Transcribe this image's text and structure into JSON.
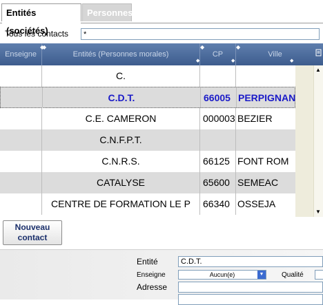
{
  "tabs": [
    {
      "label": "Entités (sociétés)",
      "active": true
    },
    {
      "label": "Personnes",
      "active": false
    }
  ],
  "filter": {
    "label": "Tous les contacts",
    "value": "*"
  },
  "grid": {
    "columns": [
      {
        "label": "Enseigne"
      },
      {
        "label": "Entités (Personnes morales)"
      },
      {
        "label": "CP"
      },
      {
        "label": "Ville"
      }
    ],
    "columns_icon": "document-icon",
    "rows": [
      {
        "enseigne": "",
        "entite": "C.",
        "cp": "",
        "ville": "",
        "selected": false
      },
      {
        "enseigne": "",
        "entite": "C.D.T.",
        "cp": "66005",
        "ville": "PERPIGNAN",
        "selected": true
      },
      {
        "enseigne": "",
        "entite": "C.E. CAMERON",
        "cp": "000003",
        "ville": "BEZIER",
        "selected": false
      },
      {
        "enseigne": "",
        "entite": "C.N.F.P.T.",
        "cp": "",
        "ville": "",
        "selected": false
      },
      {
        "enseigne": "",
        "entite": "C.N.R.S.",
        "cp": "66125",
        "ville": "FONT ROM",
        "selected": false
      },
      {
        "enseigne": "",
        "entite": "CATALYSE",
        "cp": "65600",
        "ville": "SEMEAC",
        "selected": false
      },
      {
        "enseigne": "",
        "entite": "CENTRE DE FORMATION LE P",
        "cp": "66340",
        "ville": "OSSEJA",
        "selected": false
      }
    ],
    "selection_color": "#1a1ac8",
    "header_color": "#4a6a9c"
  },
  "buttons": {
    "new_contact_line1": "Nouveau",
    "new_contact_line2": "contact"
  },
  "detail": {
    "entite_label": "Entité",
    "entite_value": "C.D.T.",
    "enseigne_label": "Enseigne",
    "enseigne_value": "Aucun(e)",
    "qualite_label": "Qualité",
    "adresse_label": "Adresse"
  }
}
